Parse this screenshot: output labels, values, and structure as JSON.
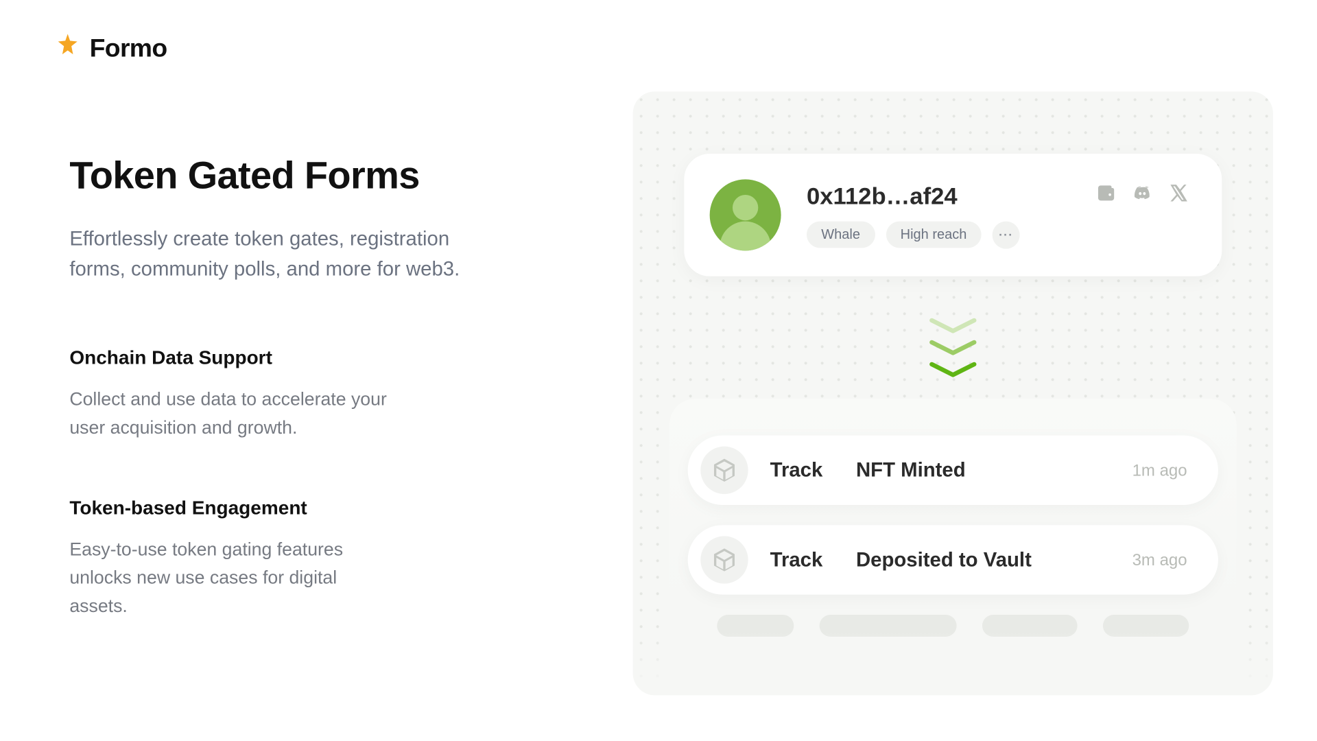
{
  "header": {
    "brand": "Formo"
  },
  "hero": {
    "title": "Token Gated Forms",
    "subtitle": "Effortlessly create token gates, registration forms, community polls, and more for web3."
  },
  "features": [
    {
      "title": "Onchain Data Support",
      "desc": "Collect and use data to accelerate your user acquisition and growth."
    },
    {
      "title": "Token-based Engagement",
      "desc": "Easy-to-use token gating features unlocks new use cases for digital assets."
    }
  ],
  "user_card": {
    "address": "0x112b…af24",
    "badges": [
      "Whale",
      "High reach"
    ],
    "more_indicator": "···",
    "social": [
      "wallet",
      "discord",
      "x"
    ]
  },
  "activity": {
    "rows": [
      {
        "label": "Track",
        "event": "NFT Minted",
        "time": "1m ago"
      },
      {
        "label": "Track",
        "event": "Deposited to Vault",
        "time": "3m ago"
      }
    ]
  },
  "colors": {
    "accent_green": "#7cb342",
    "chevron_light": "#cfe6b6",
    "chevron_mid": "#9ccc65",
    "chevron_dark": "#66bb2a"
  }
}
